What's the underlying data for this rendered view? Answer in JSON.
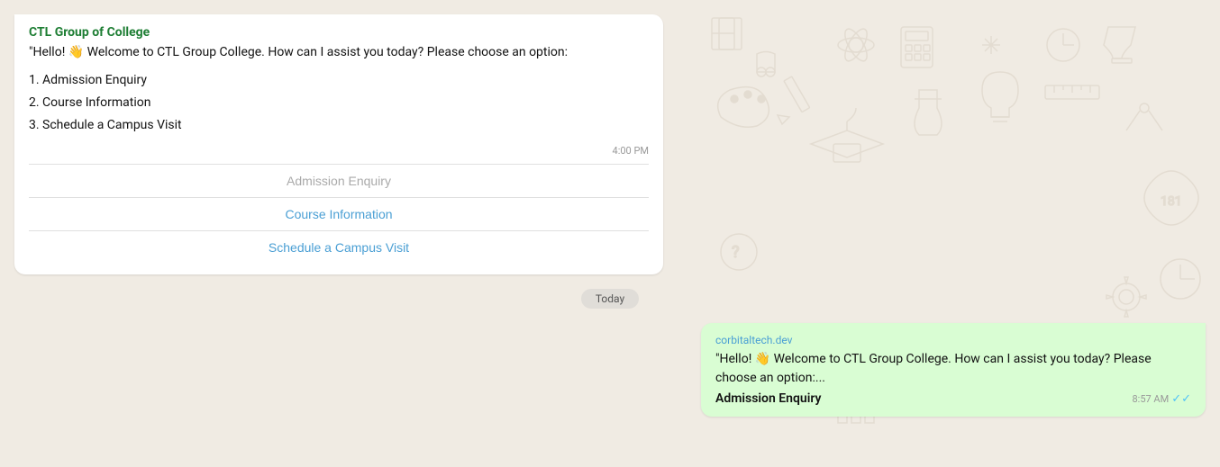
{
  "background": {
    "color": "#f0ebe3"
  },
  "chat": {
    "bot_message": {
      "sender": "CTL Group of College",
      "greeting": "\"Hello! 👋 Welcome to CTL  Group College. How can I assist you today? Please choose an option:",
      "options_list": [
        "1. Admission Enquiry",
        "2. Course Information",
        "3. Schedule a Campus Visit"
      ],
      "time": "4:00 PM",
      "buttons": [
        {
          "label": "Admission Enquiry",
          "style": "inactive"
        },
        {
          "label": "Course Information",
          "style": "active"
        },
        {
          "label": "Schedule a Campus Visit",
          "style": "active"
        }
      ]
    },
    "today_label": "Today",
    "user_message": {
      "link": "corbitaltech.dev",
      "preview_text": "\"Hello! 👋 Welcome to CTL  Group College. How can I assist you today? Please choose an option:...",
      "selected_option": "Admission Enquiry",
      "time": "8:57 AM",
      "read_receipt": "✓✓"
    }
  }
}
